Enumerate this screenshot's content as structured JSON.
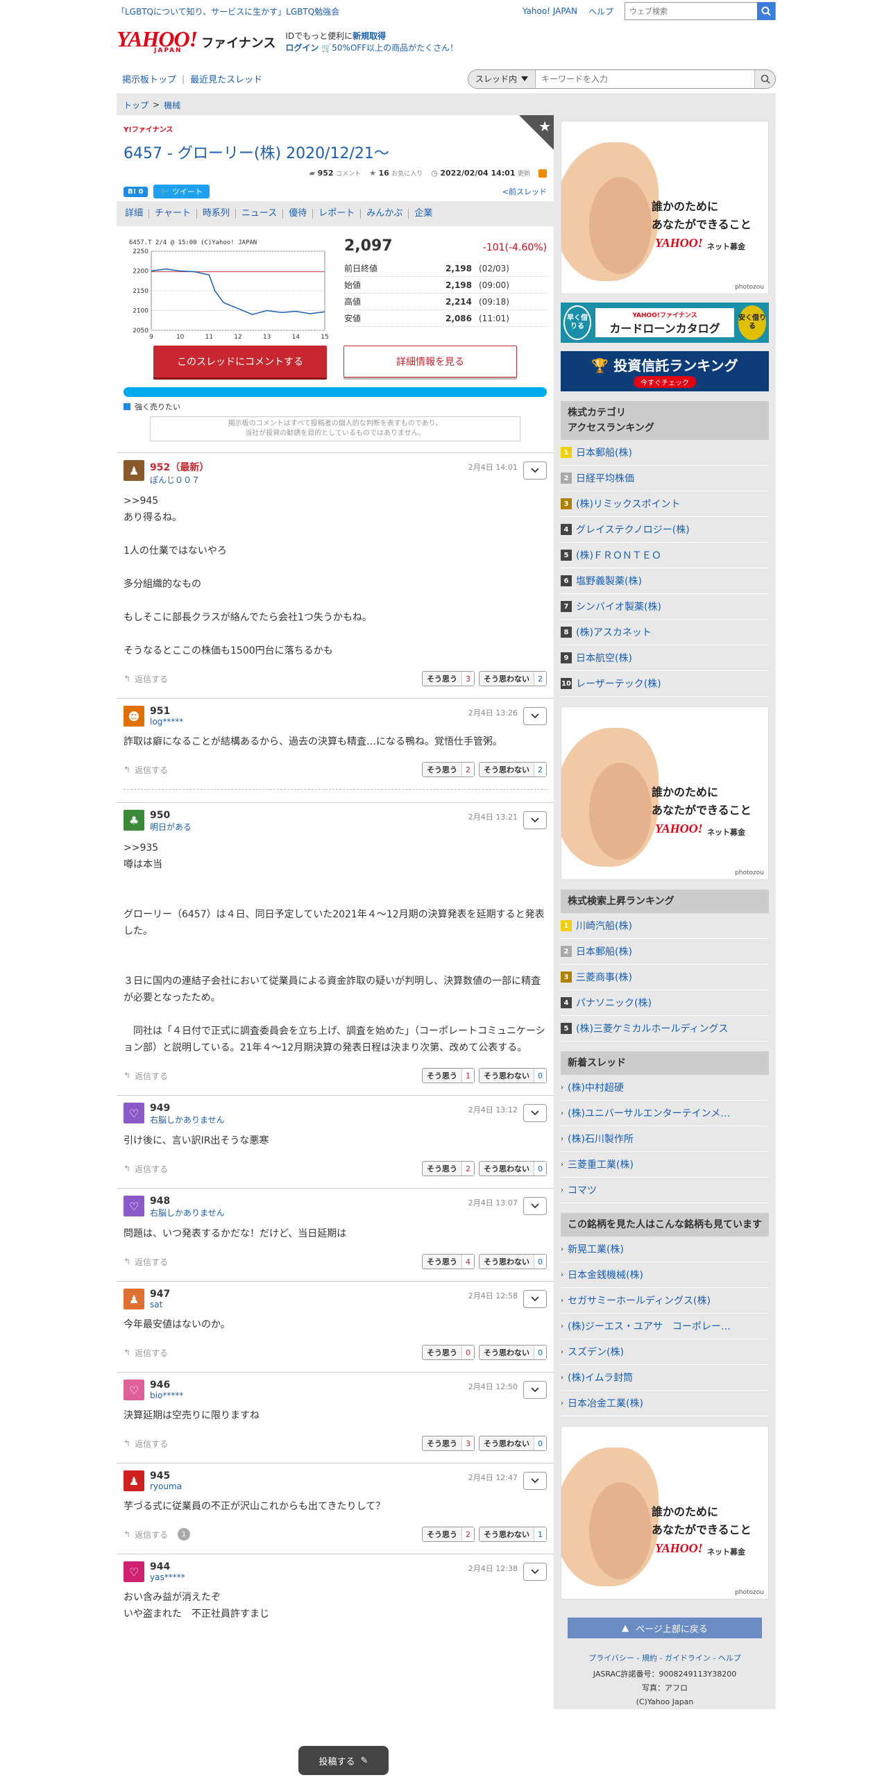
{
  "header": {
    "promo": "「LGBTQについて知り、サービスに生かす」LGBTQ勉強会",
    "top_links": [
      "Yahoo! JAPAN",
      "ヘルプ"
    ],
    "web_search_placeholder": "ウェブ検索",
    "logo_main": "YAHOO!",
    "logo_sub": "JAPAN",
    "logo_finance": "ファイナンス",
    "msg_line1_prefix": "IDでもっと便利に",
    "msg_line1_link": "新規取得",
    "msg_login": "ログイン",
    "msg_line2": "50%OFF以上の商品がたくさん！",
    "nav_links": [
      "掲示板トップ",
      "最近見たスレッド"
    ],
    "thread_search_scope": "スレッド内",
    "thread_search_placeholder": "キーワードを入力"
  },
  "breadcrumb": [
    "トップ",
    "機械"
  ],
  "thread": {
    "finance_mini": "Y!ファイナンス",
    "title": "6457 - グローリー(株) 2020/12/21〜",
    "comments_count": "952",
    "comments_label": "コメント",
    "fav_count": "16",
    "fav_label": "お気に入り",
    "updated": "2022/02/04 14:01",
    "updated_label": "更新",
    "hatena": "B! 0",
    "tweet": "ツイート",
    "prev": "<前スレッド"
  },
  "tabs": [
    "詳細",
    "チャート",
    "時系列",
    "ニュース",
    "優待",
    "レポート",
    "みんかぶ",
    "企業"
  ],
  "quote": {
    "chart_header": "6457.T      2/4 @ 15:00      (C)Yahoo! JAPAN",
    "price": "2,097",
    "change": "-101(-4.60%)",
    "rows": [
      {
        "k": "前日終値",
        "v": "2,198",
        "t": "(02/03)"
      },
      {
        "k": "始値",
        "v": "2,198",
        "t": "(09:00)"
      },
      {
        "k": "高値",
        "v": "2,214",
        "t": "(09:18)"
      },
      {
        "k": "安値",
        "v": "2,086",
        "t": "(11:01)"
      }
    ]
  },
  "chart_data": {
    "type": "line",
    "x": [
      9,
      9.5,
      10,
      10.5,
      11,
      11.2,
      11.5,
      12,
      12.5,
      13,
      13.5,
      14,
      14.5,
      15
    ],
    "values": [
      2200,
      2205,
      2200,
      2198,
      2190,
      2150,
      2120,
      2105,
      2090,
      2100,
      2095,
      2098,
      2092,
      2097
    ],
    "xticks": [
      "9",
      "10",
      "11",
      "12",
      "13",
      "14",
      "15"
    ],
    "yticks": [
      "2250",
      "2200",
      "2150",
      "2100",
      "2050"
    ],
    "ylim": [
      2050,
      2250
    ],
    "reference_line": 2198
  },
  "actions": {
    "comment": "このスレッドにコメントする",
    "detail": "詳細情報を見る",
    "sentiment": "強く売りたい",
    "disclaimer_1": "掲示板のコメントはすべて投稿者の個人的な判断を表すものであり、",
    "disclaimer_2": "当社が投資の勧誘を目的としているものではありません。"
  },
  "posts": [
    {
      "num": "952（最新）",
      "user": "ぽんじ００７",
      "date": "2月4日 14:01",
      "color": "#8b5a2b",
      "body": ">>945\nあり得るね。\n\n1人の仕業ではないやろ\n\n多分組織的なもの\n\nもしそこに部長クラスが絡んでたら会社1つ失うかもね。\n\nそうなるとここの株価も1500円台に落ちるかも",
      "agree": "3",
      "disagree": "2"
    },
    {
      "num": "951",
      "user": "log*****",
      "date": "2月4日 13:26",
      "color": "#e07000",
      "body": "詐取は癖になることが結構あるから、過去の決算も精査…になる鴨ね。覚悟仕手管粥。",
      "agree": "2",
      "disagree": "2"
    },
    {
      "num": "950",
      "user": "明日がある",
      "date": "2月4日 13:21",
      "color": "#3a8a3a",
      "body": ">>935\n噂は本当\n\n\nグローリー（6457）は４日、同日予定していた2021年４～12月期の決算発表を延期すると発表した。\n\n\n３日に国内の連結子会社において従業員による資金詐取の疑いが判明し、決算数値の一部に精査が必要となったため。\n\n　同社は「４日付で正式に調査委員会を立ち上げ、調査を始めた」（コーポレートコミュニケーション部）と説明している。21年４～12月期決算の発表日程は決まり次第、改めて公表する。",
      "agree": "1",
      "disagree": "0"
    },
    {
      "num": "949",
      "user": "右脳しかありません",
      "date": "2月4日 13:12",
      "color": "#8a5ac8",
      "body": "引け後に、言い訳IR出そうな悪寒",
      "agree": "2",
      "disagree": "0"
    },
    {
      "num": "948",
      "user": "右脳しかありません",
      "date": "2月4日 13:07",
      "color": "#8a5ac8",
      "body": "問題は、いつ発表するかだな！だけど、当日延期は",
      "agree": "4",
      "disagree": "0"
    },
    {
      "num": "947",
      "user": "sat",
      "date": "2月4日 12:58",
      "color": "#e07030",
      "body": "今年最安値はないのか。",
      "agree": "0",
      "disagree": "0"
    },
    {
      "num": "946",
      "user": "bio*****",
      "date": "2月4日 12:50",
      "color": "#e0609a",
      "body": "決算延期は空売りに限りますね",
      "agree": "3",
      "disagree": "0"
    },
    {
      "num": "945",
      "user": "ryouma",
      "date": "2月4日 12:47",
      "color": "#d02020",
      "body": "芋づる式に従業員の不正が沢山これからも出てきたりして？",
      "agree": "2",
      "disagree": "1",
      "replies": "1"
    },
    {
      "num": "944",
      "user": "yas*****",
      "date": "2月4日 12:38",
      "color": "#d02070",
      "body": "おい含み益が消えたぞ\nいや盗まれた　不正社員許すまじ",
      "agree": "",
      "disagree": ""
    }
  ],
  "post_labels": {
    "reply": "返信する",
    "agree": "そう思う",
    "disagree": "そう思わない",
    "fab": "投稿する"
  },
  "ads": {
    "copy_1": "誰かのために",
    "copy_2": "あなたができること",
    "brand": "YAHOO!",
    "brand_sub": "ネット募金",
    "credit": "photozou"
  },
  "banners": {
    "loan_left": "早く借りる",
    "loan_brand": "YAHOO!ファイナンス",
    "loan_title": "カードローンカタログ",
    "loan_right": "安く借りる",
    "fund_title": "投資信託ランキング",
    "fund_cta": "今すぐチェック"
  },
  "side": {
    "access_title": "株式カテゴリ\nアクセスランキング",
    "access": [
      "日本郵船(株)",
      "日経平均株価",
      "(株)リミックスポイント",
      "グレイステクノロジー(株)",
      "(株)ＦＲＯＮＴＥＯ",
      "塩野義製薬(株)",
      "シンバイオ製薬(株)",
      "(株)アスカネット",
      "日本航空(株)",
      "レーザーテック(株)"
    ],
    "rise_title": "株式検索上昇ランキング",
    "rise": [
      "川崎汽船(株)",
      "日本郵船(株)",
      "三菱商事(株)",
      "パナソニック(株)",
      "(株)三菱ケミカルホールディングス"
    ],
    "new_title": "新着スレッド",
    "new": [
      "(株)中村超硬",
      "(株)ユニバーサルエンターテインメ…",
      "(株)石川製作所",
      "三菱重工業(株)",
      "コマツ"
    ],
    "also_title": "この銘柄を見た人はこんな銘柄も見ています",
    "also": [
      "新晃工業(株)",
      "日本金銭機械(株)",
      "セガサミーホールディングス(株)",
      "(株)ジーエス・ユアサ　コーポレー…",
      "スズデン(株)",
      "(株)イムラ封筒",
      "日本冶金工業(株)"
    ],
    "pagetop": "ページ上部に戻る",
    "foot_links": "プライバシー - 規約 - ガイドライン - ヘルプ",
    "jasrac": "JASRAC許諾番号：9008249113Y38200",
    "photo": "写真：アフロ",
    "copyright": "(C)Yahoo Japan"
  }
}
